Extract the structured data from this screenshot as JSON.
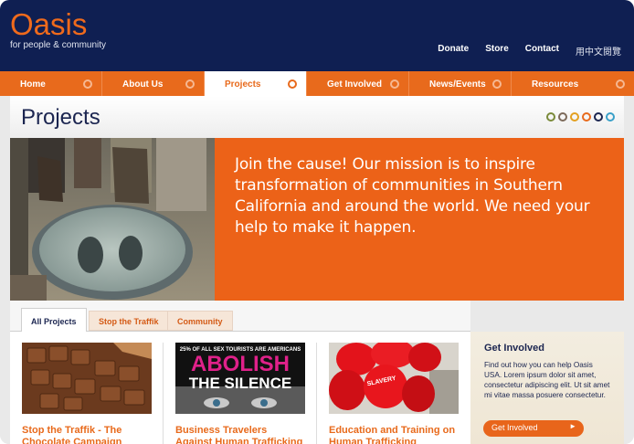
{
  "header": {
    "logo_word": "Oasis",
    "logo_tagline": "for people & community",
    "top_links": [
      "Donate",
      "Store",
      "Contact",
      "用中文閱覽"
    ]
  },
  "nav": {
    "items": [
      "Home",
      "About Us",
      "Projects",
      "Get Involved",
      "News/Events",
      "Resources"
    ],
    "active": "Projects"
  },
  "page": {
    "title": "Projects",
    "dot_colors": [
      "#7a8a3a",
      "#7c6a5a",
      "#e3a020",
      "#e86a1c",
      "#1b2550",
      "#3aa0c8"
    ]
  },
  "hero": {
    "text": "Join the cause! Our mission is to inspire transformation of communities in Southern California and around the world. We need your help to make it happen."
  },
  "tabs": {
    "items": [
      "All Projects",
      "Stop the Traffik",
      "Community"
    ],
    "active": "All Projects"
  },
  "cards": [
    {
      "title": "Stop the Traffik - The Chocolate Campaign"
    },
    {
      "title": "Business Travelers Against Human Trafficking",
      "image_text_top": "25% OF ALL SEX TOURISTS ARE AMERICANS",
      "image_text_main": "ABOLISH",
      "image_text_sub": "THE SILENCE"
    },
    {
      "title": "Education and Training on Human Trafficking",
      "image_text": "SLAVERY"
    }
  ],
  "sidebar": {
    "title": "Get Involved",
    "text": "Find out how you can help Oasis USA. Lorem ipsum dolor sit amet, consectetur adipiscing elit. Ut sit amet mi vitae massa posuere consectetur.",
    "button_label": "Get Involved",
    "button_arrow": "►"
  }
}
